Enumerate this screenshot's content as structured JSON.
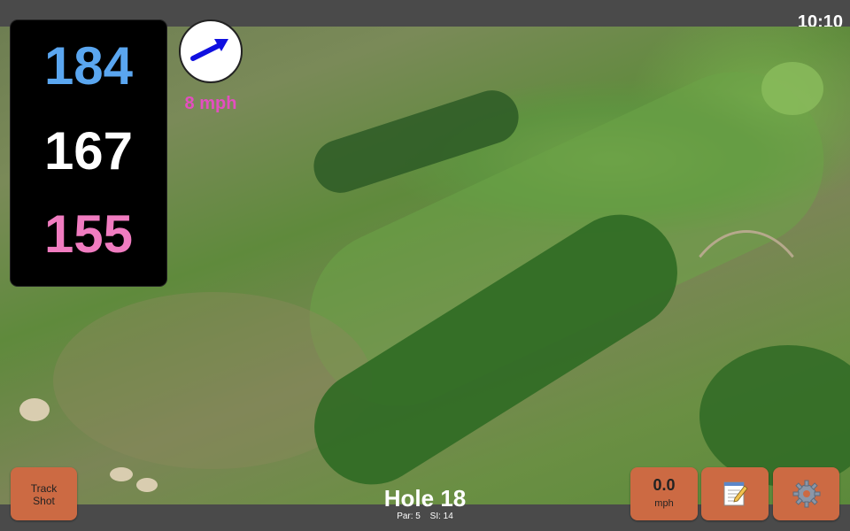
{
  "status_bar": {
    "time": "10:10"
  },
  "distances": {
    "back": "184",
    "middle": "167",
    "front": "155"
  },
  "wind": {
    "speed": "8 mph",
    "icon": "arrow-icon",
    "arrow_color": "#1010e0"
  },
  "buttons": {
    "track_shot": {
      "line1": "Track",
      "line2": "Shot"
    },
    "speed": {
      "value": "0.0",
      "unit": "mph"
    },
    "scorecard": {
      "icon": "notepad-icon"
    },
    "settings": {
      "icon": "gear-icon"
    }
  },
  "hole": {
    "title": "Hole 18",
    "par": "Par: 5",
    "si": "SI: 14"
  },
  "colors": {
    "accent_button": "#cc6a43",
    "back_distance": "#5aa6f0",
    "front_distance": "#f07cc0",
    "wind_speed": "#e44ec0"
  }
}
